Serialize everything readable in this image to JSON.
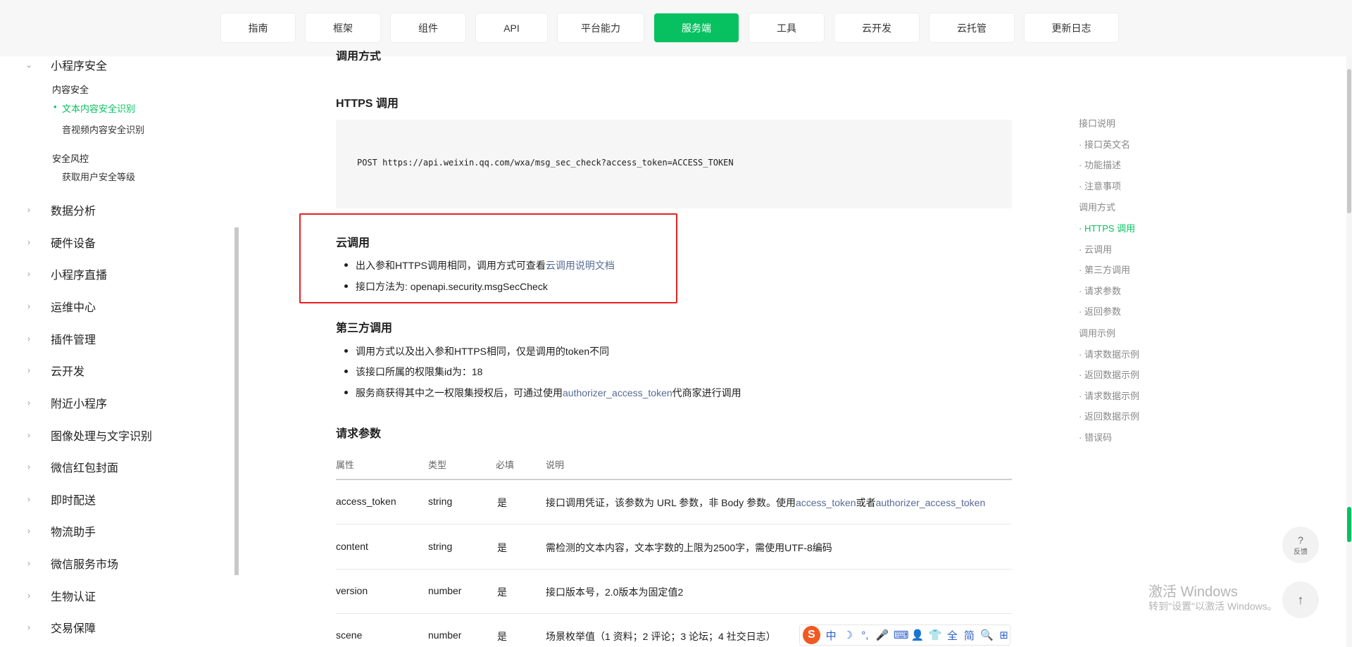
{
  "topnav": {
    "tabs": [
      {
        "label": "指南",
        "active": false
      },
      {
        "label": "框架",
        "active": false
      },
      {
        "label": "组件",
        "active": false
      },
      {
        "label": "API",
        "active": false
      },
      {
        "label": "平台能力",
        "active": false
      },
      {
        "label": "服务端",
        "active": true
      },
      {
        "label": "工具",
        "active": false
      },
      {
        "label": "云开发",
        "active": false
      },
      {
        "label": "云托管",
        "active": false
      },
      {
        "label": "更新日志",
        "active": false
      }
    ]
  },
  "sidebar": {
    "expanded_section": "小程序安全",
    "groups": [
      {
        "title": "内容安全",
        "items": [
          "文本内容安全识别",
          "音视频内容安全识别"
        ]
      },
      {
        "title": "安全风控",
        "items": [
          "获取用户安全等级"
        ]
      }
    ],
    "active_item": "文本内容安全识别",
    "sections": [
      "数据分析",
      "硬件设备",
      "小程序直播",
      "运维中心",
      "插件管理",
      "云开发",
      "附近小程序",
      "图像处理与文字识别",
      "微信红包封面",
      "即时配送",
      "物流助手",
      "微信服务市场",
      "生物认证",
      "交易保障"
    ]
  },
  "main": {
    "cut_heading": "调用方式",
    "https_heading": "HTTPS 调用",
    "https_code": "POST https://api.weixin.qq.com/wxa/msg_sec_check?access_token=ACCESS_TOKEN",
    "cloud_heading": "云调用",
    "cloud_bullet1_prefix": "出入参和HTTPS调用相同，调用方式可查看",
    "cloud_bullet1_link": "云调用说明文档",
    "cloud_bullet2": "接口方法为: openapi.security.msgSecCheck",
    "third_heading": "第三方调用",
    "third_bullet1": "调用方式以及出入参和HTTPS相同，仅是调用的token不同",
    "third_bullet2": "该接口所属的权限集id为：18",
    "third_bullet3_prefix": "服务商获得其中之一权限集授权后，可通过使用",
    "third_bullet3_link": "authorizer_access_token",
    "third_bullet3_suffix": "代商家进行调用",
    "params_heading": "请求参数",
    "table": {
      "headers": [
        "属性",
        "类型",
        "必填",
        "说明"
      ],
      "rows": [
        {
          "name": "access_token",
          "type": "string",
          "required": "是",
          "desc_prefix": "接口调用凭证，该参数为 URL 参数，非 Body 参数。使用",
          "link1": "access_token",
          "mid": "或者",
          "link2": "authorizer_access_token"
        },
        {
          "name": "content",
          "type": "string",
          "required": "是",
          "desc": "需检测的文本内容，文本字数的上限为2500字，需使用UTF-8编码"
        },
        {
          "name": "version",
          "type": "number",
          "required": "是",
          "desc": "接口版本号，2.0版本为固定值2"
        },
        {
          "name": "scene",
          "type": "number",
          "required": "是",
          "desc": "场景枚举值（1 资料；2 评论；3 论坛；4 社交日志）"
        }
      ]
    }
  },
  "toc": {
    "items": [
      {
        "label": "接口说明",
        "sub": false,
        "active": false
      },
      {
        "label": "接口英文名",
        "sub": true,
        "active": false
      },
      {
        "label": "功能描述",
        "sub": true,
        "active": false
      },
      {
        "label": "注意事项",
        "sub": true,
        "active": false
      },
      {
        "label": "调用方式",
        "sub": false,
        "active": false
      },
      {
        "label": "HTTPS 调用",
        "sub": true,
        "active": true
      },
      {
        "label": "云调用",
        "sub": true,
        "active": false
      },
      {
        "label": "第三方调用",
        "sub": true,
        "active": false
      },
      {
        "label": "请求参数",
        "sub": true,
        "active": false
      },
      {
        "label": "返回参数",
        "sub": true,
        "active": false
      },
      {
        "label": "调用示例",
        "sub": false,
        "active": false
      },
      {
        "label": "请求数据示例",
        "sub": true,
        "active": false
      },
      {
        "label": "返回数据示例",
        "sub": true,
        "active": false
      },
      {
        "label": "请求数据示例",
        "sub": true,
        "active": false
      },
      {
        "label": "返回数据示例",
        "sub": true,
        "active": false
      },
      {
        "label": "错误码",
        "sub": true,
        "active": false
      }
    ]
  },
  "feedback": {
    "symbol": "?",
    "label": "反馈"
  },
  "back_top_symbol": "↑",
  "watermark": {
    "line1": "激活 Windows",
    "line2": "转到\"设置\"以激活 Windows。"
  },
  "ime": {
    "logo": "S",
    "items": [
      "中",
      "☽",
      "°,",
      "🎤",
      "⌨",
      "👤",
      "👕",
      "全",
      "简",
      "🔍",
      "⊞"
    ]
  },
  "colors": {
    "accent": "#07c160",
    "highlight_border": "#e32222",
    "link": "#576b95"
  }
}
